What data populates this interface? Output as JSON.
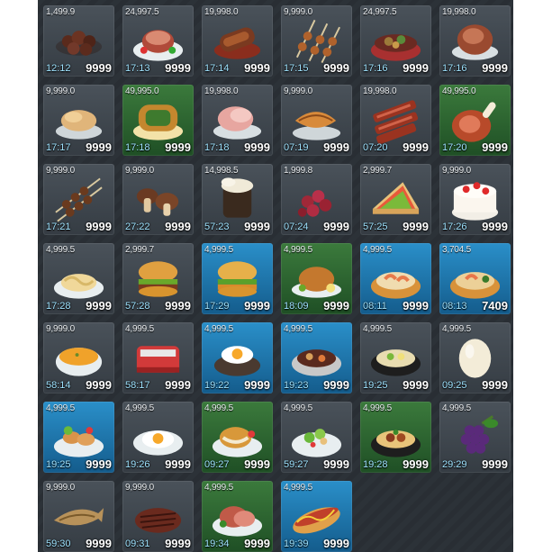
{
  "items": [
    {
      "name": "dried-fruit",
      "price": "1,499.9",
      "timer": "12:12",
      "qty": "9999",
      "bg": "gray"
    },
    {
      "name": "roast-platter",
      "price": "24,997.5",
      "timer": "17:13",
      "qty": "9999",
      "bg": "gray"
    },
    {
      "name": "glazed-meat",
      "price": "19,998.0",
      "timer": "17:14",
      "qty": "9999",
      "bg": "gray"
    },
    {
      "name": "skewers",
      "price": "9,999.0",
      "timer": "17:15",
      "qty": "9999",
      "bg": "gray"
    },
    {
      "name": "stew-bowl",
      "price": "24,997.5",
      "timer": "17:16",
      "qty": "9999",
      "bg": "gray"
    },
    {
      "name": "ham-roast",
      "price": "19,998.0",
      "timer": "17:16",
      "qty": "9999",
      "bg": "gray"
    },
    {
      "name": "fried-chicken",
      "price": "9,999.0",
      "timer": "17:17",
      "qty": "9999",
      "bg": "gray"
    },
    {
      "name": "stuffed-roast",
      "price": "49,995.0",
      "timer": "17:18",
      "qty": "9999",
      "bg": "green"
    },
    {
      "name": "sliced-ham",
      "price": "19,998.0",
      "timer": "17:18",
      "qty": "9999",
      "bg": "gray"
    },
    {
      "name": "grilled-fish",
      "price": "9,999.0",
      "timer": "07:19",
      "qty": "9999",
      "bg": "gray"
    },
    {
      "name": "bacon-strips",
      "price": "19,998.0",
      "timer": "07:20",
      "qty": "9999",
      "bg": "gray"
    },
    {
      "name": "meat-leg",
      "price": "49,995.0",
      "timer": "17:20",
      "qty": "9999",
      "bg": "green"
    },
    {
      "name": "kebab-sticks",
      "price": "9,999.0",
      "timer": "17:21",
      "qty": "9999",
      "bg": "gray"
    },
    {
      "name": "mushrooms",
      "price": "9,999.0",
      "timer": "27:22",
      "qty": "9999",
      "bg": "gray"
    },
    {
      "name": "dark-drink",
      "price": "14,998.5",
      "timer": "57:23",
      "qty": "9999",
      "bg": "gray"
    },
    {
      "name": "berries",
      "price": "1,999.8",
      "timer": "07:24",
      "qty": "9999",
      "bg": "gray"
    },
    {
      "name": "sandwich",
      "price": "2,999.7",
      "timer": "57:25",
      "qty": "9999",
      "bg": "gray"
    },
    {
      "name": "strawberry-cake",
      "price": "9,999.0",
      "timer": "17:26",
      "qty": "9999",
      "bg": "gray"
    },
    {
      "name": "pasta",
      "price": "4,999.5",
      "timer": "17:28",
      "qty": "9999",
      "bg": "gray"
    },
    {
      "name": "burger",
      "price": "2,999.7",
      "timer": "57:28",
      "qty": "9999",
      "bg": "gray"
    },
    {
      "name": "chicken-burger",
      "price": "4,999.5",
      "timer": "17:29",
      "qty": "9999",
      "bg": "blue"
    },
    {
      "name": "roast-chicken",
      "price": "4,999.5",
      "timer": "18:09",
      "qty": "9999",
      "bg": "green"
    },
    {
      "name": "shrimp-rice",
      "price": "4,999.5",
      "timer": "08:11",
      "qty": "9999",
      "bg": "blue"
    },
    {
      "name": "seafood-paella",
      "price": "3,704.5",
      "timer": "08:13",
      "qty": "7409",
      "bg": "blue"
    },
    {
      "name": "soup-bowl",
      "price": "9,999.0",
      "timer": "58:14",
      "qty": "9999",
      "bg": "gray"
    },
    {
      "name": "lunch-box",
      "price": "4,999.5",
      "timer": "58:17",
      "qty": "9999",
      "bg": "gray"
    },
    {
      "name": "egg-steak",
      "price": "4,999.5",
      "timer": "19:22",
      "qty": "9999",
      "bg": "blue"
    },
    {
      "name": "beef-stew",
      "price": "4,999.5",
      "timer": "19:23",
      "qty": "9999",
      "bg": "blue"
    },
    {
      "name": "noodle-bowl",
      "price": "4,999.5",
      "timer": "19:25",
      "qty": "9999",
      "bg": "gray"
    },
    {
      "name": "egg",
      "price": "4,999.5",
      "timer": "09:25",
      "qty": "9999",
      "bg": "gray"
    },
    {
      "name": "salad-nuggets",
      "price": "4,999.5",
      "timer": "19:25",
      "qty": "9999",
      "bg": "blue"
    },
    {
      "name": "fried-egg",
      "price": "4,999.5",
      "timer": "19:26",
      "qty": "9999",
      "bg": "gray"
    },
    {
      "name": "cutlet-plate",
      "price": "4,999.5",
      "timer": "09:27",
      "qty": "9999",
      "bg": "green"
    },
    {
      "name": "caesar-salad",
      "price": "4,999.5",
      "timer": "59:27",
      "qty": "9999",
      "bg": "gray"
    },
    {
      "name": "meat-noodles",
      "price": "4,999.5",
      "timer": "19:28",
      "qty": "9999",
      "bg": "green"
    },
    {
      "name": "grapes",
      "price": "4,999.5",
      "timer": "29:29",
      "qty": "9999",
      "bg": "gray"
    },
    {
      "name": "dried-fish",
      "price": "9,999.0",
      "timer": "59:30",
      "qty": "9999",
      "bg": "gray"
    },
    {
      "name": "steak",
      "price": "9,999.0",
      "timer": "09:31",
      "qty": "9999",
      "bg": "gray"
    },
    {
      "name": "roast-beef",
      "price": "4,999.5",
      "timer": "19:34",
      "qty": "9999",
      "bg": "green"
    },
    {
      "name": "hot-dog",
      "price": "4,999.5",
      "timer": "19:39",
      "qty": "9999",
      "bg": "blue"
    }
  ]
}
